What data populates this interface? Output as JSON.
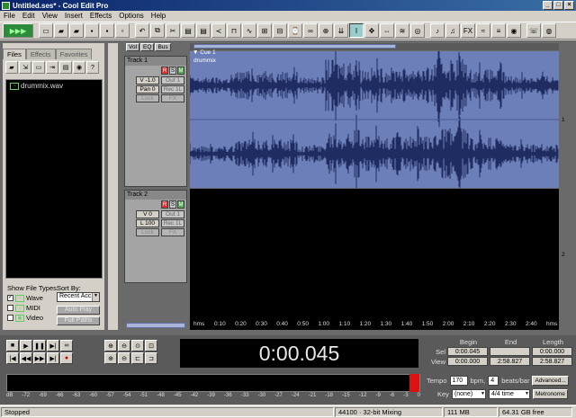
{
  "window": {
    "title": "Untitled.ses* - Cool Edit Pro"
  },
  "menu": [
    "File",
    "Edit",
    "View",
    "Insert",
    "Effects",
    "Options",
    "Help"
  ],
  "left_panel": {
    "tabs": [
      "Files",
      "Effects",
      "Favorites"
    ],
    "files": [
      "drummix.wav"
    ],
    "show_file_types_label": "Show File Types:",
    "sort_by_label": "Sort By:",
    "sort_value": "Recent Acc",
    "types": [
      "Wave",
      "MIDI",
      "Video"
    ],
    "auto_play_label": "Auto Play",
    "full_paths_label": "Full Paths"
  },
  "track_panel": {
    "tab_buttons": [
      "Vol",
      "EQ",
      "Bus"
    ],
    "track1": {
      "name": "Track 1",
      "volume": "V -1.0",
      "pan": "Pan 0",
      "out": "Out 1",
      "rec": "Rec 1L",
      "lock": "Lock",
      "fx": "FX"
    },
    "track2": {
      "name": "Track 2",
      "volume": "V 0",
      "pan": "L 100",
      "out": "Out 1",
      "rec": "Rec 1L",
      "lock": "Lock",
      "fx": "FX"
    },
    "rsm": [
      "R",
      "S",
      "M"
    ]
  },
  "timeline": {
    "cue": "Cue 1",
    "clip_name": "drummix",
    "ruler_labels": [
      "hms",
      "0:10",
      "0:20",
      "0:30",
      "0:40",
      "0:50",
      "1:00",
      "1:10",
      "1:20",
      "1:30",
      "1:40",
      "1:50",
      "2:00",
      "2:10",
      "2:20",
      "2:30",
      "2:40",
      "hms"
    ],
    "right_scale": [
      "1",
      "2"
    ]
  },
  "time_display": "0:00.045",
  "selection": {
    "headers": [
      "Begin",
      "End",
      "Length"
    ],
    "sel_label": "Sel",
    "view_label": "View",
    "sel": [
      "0:00.045",
      "",
      "0:00.000"
    ],
    "view": [
      "0:00.000",
      "2:58.827",
      "2:58.827"
    ]
  },
  "level_scale": [
    "dB",
    "-72",
    "-69",
    "-66",
    "-63",
    "-60",
    "-57",
    "-54",
    "-51",
    "-48",
    "-45",
    "-42",
    "-39",
    "-36",
    "-33",
    "-30",
    "-27",
    "-24",
    "-21",
    "-18",
    "-15",
    "-12",
    "-9",
    "-6",
    "-3",
    "0"
  ],
  "tempo": {
    "tempo_label": "Tempo",
    "tempo_value": "170",
    "bpm_label": "bpm,",
    "beats_value": "4",
    "beats_label": "beats/bar",
    "advanced_label": "Advanced...",
    "key_label": "Key",
    "key_value": "(none)",
    "time_sig": "4/4 time",
    "metronome_label": "Metronome"
  },
  "status": {
    "state": "Stopped",
    "format": "44100 · 32-bit Mixing",
    "memory": "111 MB",
    "disk": "64.31 GB free"
  },
  "colors": {
    "waveform_bg": "#6d7fb8",
    "waveform": "#1e2c62",
    "peak": "#dd1111"
  }
}
